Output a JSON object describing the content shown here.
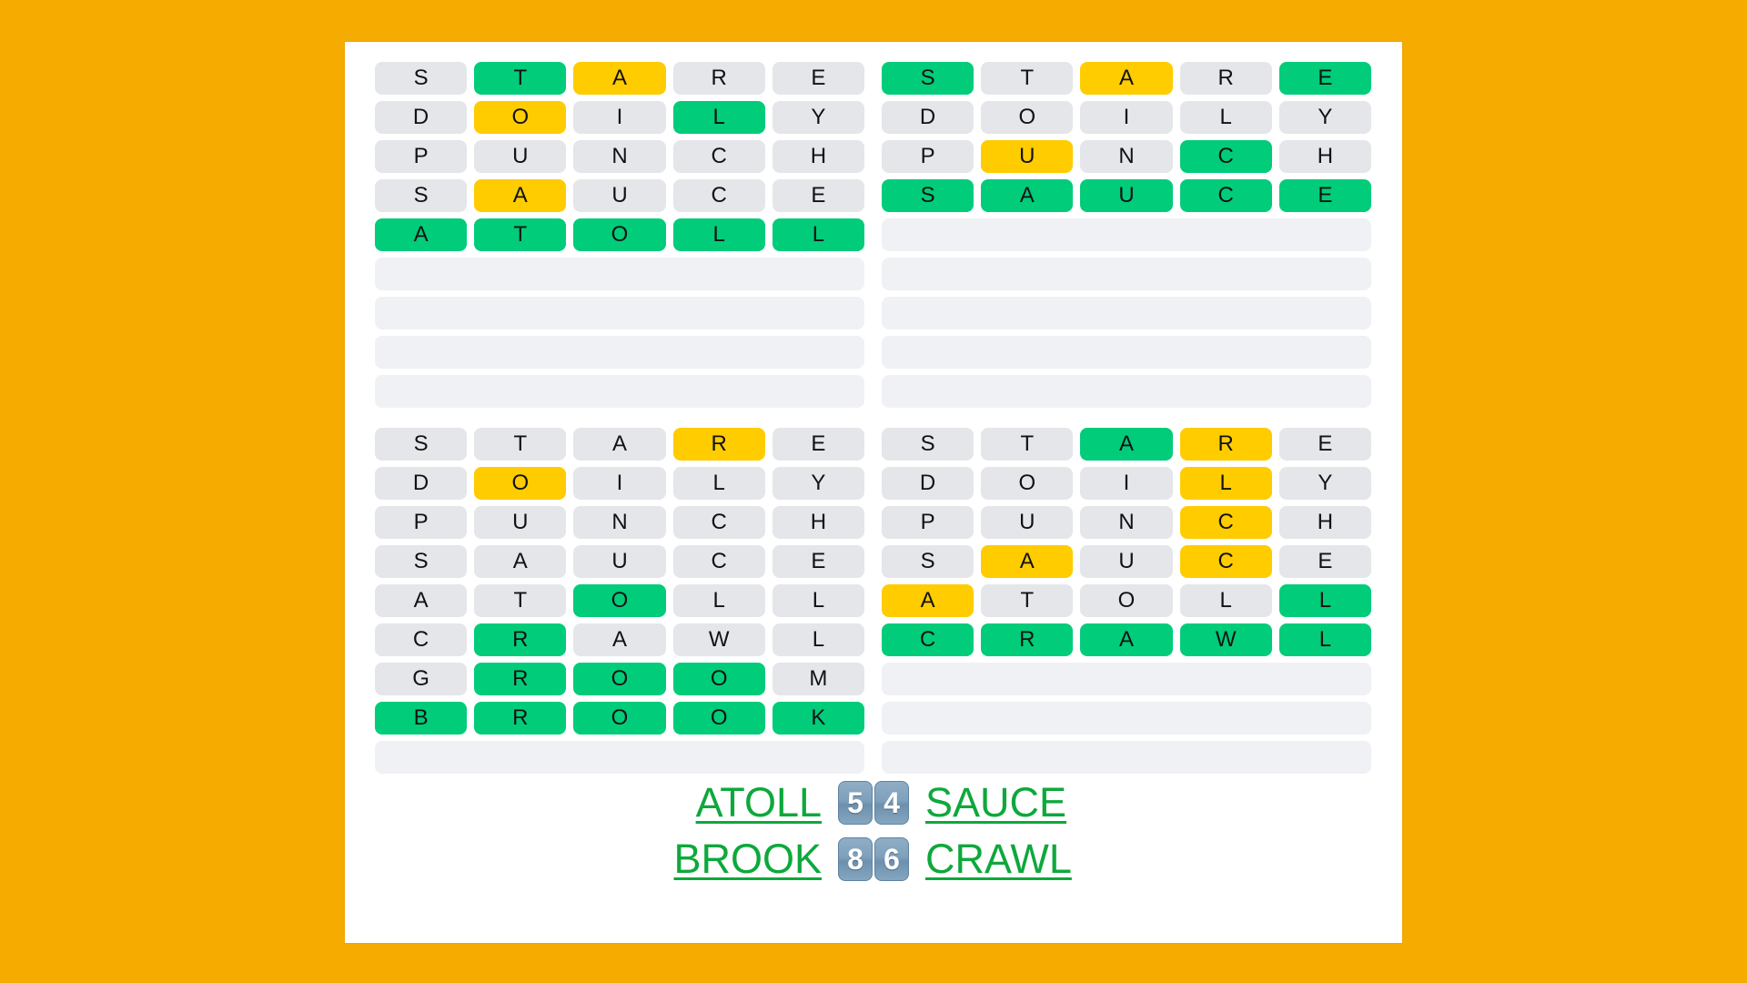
{
  "page": {
    "background_color": "#f5ab00",
    "card_color": "#ffffff"
  },
  "colors": {
    "correct": "#00cc7a",
    "present": "#ffcc00",
    "absent": "#e4e6ea",
    "empty_row": "#f0f1f4",
    "word_link": "#0ea83c",
    "number_box": "#7fa0bb"
  },
  "boards": [
    {
      "id": "board-top-left",
      "rows": [
        {
          "letters": [
            "S",
            "T",
            "A",
            "R",
            "E"
          ],
          "states": [
            "absent",
            "correct",
            "present",
            "absent",
            "absent"
          ]
        },
        {
          "letters": [
            "D",
            "O",
            "I",
            "L",
            "Y"
          ],
          "states": [
            "absent",
            "present",
            "absent",
            "correct",
            "absent"
          ]
        },
        {
          "letters": [
            "P",
            "U",
            "N",
            "C",
            "H"
          ],
          "states": [
            "absent",
            "absent",
            "absent",
            "absent",
            "absent"
          ]
        },
        {
          "letters": [
            "S",
            "A",
            "U",
            "C",
            "E"
          ],
          "states": [
            "absent",
            "present",
            "absent",
            "absent",
            "absent"
          ]
        },
        {
          "letters": [
            "A",
            "T",
            "O",
            "L",
            "L"
          ],
          "states": [
            "correct",
            "correct",
            "correct",
            "correct",
            "correct"
          ]
        }
      ],
      "empty_rows": 4
    },
    {
      "id": "board-top-right",
      "rows": [
        {
          "letters": [
            "S",
            "T",
            "A",
            "R",
            "E"
          ],
          "states": [
            "correct",
            "absent",
            "present",
            "absent",
            "correct"
          ]
        },
        {
          "letters": [
            "D",
            "O",
            "I",
            "L",
            "Y"
          ],
          "states": [
            "absent",
            "absent",
            "absent",
            "absent",
            "absent"
          ]
        },
        {
          "letters": [
            "P",
            "U",
            "N",
            "C",
            "H"
          ],
          "states": [
            "absent",
            "present",
            "absent",
            "correct",
            "absent"
          ]
        },
        {
          "letters": [
            "S",
            "A",
            "U",
            "C",
            "E"
          ],
          "states": [
            "correct",
            "correct",
            "correct",
            "correct",
            "correct"
          ]
        }
      ],
      "empty_rows": 5
    },
    {
      "id": "board-bottom-left",
      "rows": [
        {
          "letters": [
            "S",
            "T",
            "A",
            "R",
            "E"
          ],
          "states": [
            "absent",
            "absent",
            "absent",
            "present",
            "absent"
          ]
        },
        {
          "letters": [
            "D",
            "O",
            "I",
            "L",
            "Y"
          ],
          "states": [
            "absent",
            "present",
            "absent",
            "absent",
            "absent"
          ]
        },
        {
          "letters": [
            "P",
            "U",
            "N",
            "C",
            "H"
          ],
          "states": [
            "absent",
            "absent",
            "absent",
            "absent",
            "absent"
          ]
        },
        {
          "letters": [
            "S",
            "A",
            "U",
            "C",
            "E"
          ],
          "states": [
            "absent",
            "absent",
            "absent",
            "absent",
            "absent"
          ]
        },
        {
          "letters": [
            "A",
            "T",
            "O",
            "L",
            "L"
          ],
          "states": [
            "absent",
            "absent",
            "correct",
            "absent",
            "absent"
          ]
        },
        {
          "letters": [
            "C",
            "R",
            "A",
            "W",
            "L"
          ],
          "states": [
            "absent",
            "correct",
            "absent",
            "absent",
            "absent"
          ]
        },
        {
          "letters": [
            "G",
            "R",
            "O",
            "O",
            "M"
          ],
          "states": [
            "absent",
            "correct",
            "correct",
            "correct",
            "absent"
          ]
        },
        {
          "letters": [
            "B",
            "R",
            "O",
            "O",
            "K"
          ],
          "states": [
            "correct",
            "correct",
            "correct",
            "correct",
            "correct"
          ]
        }
      ],
      "empty_rows": 1
    },
    {
      "id": "board-bottom-right",
      "rows": [
        {
          "letters": [
            "S",
            "T",
            "A",
            "R",
            "E"
          ],
          "states": [
            "absent",
            "absent",
            "correct",
            "present",
            "absent"
          ]
        },
        {
          "letters": [
            "D",
            "O",
            "I",
            "L",
            "Y"
          ],
          "states": [
            "absent",
            "absent",
            "absent",
            "present",
            "absent"
          ]
        },
        {
          "letters": [
            "P",
            "U",
            "N",
            "C",
            "H"
          ],
          "states": [
            "absent",
            "absent",
            "absent",
            "present",
            "absent"
          ]
        },
        {
          "letters": [
            "S",
            "A",
            "U",
            "C",
            "E"
          ],
          "states": [
            "absent",
            "present",
            "absent",
            "present",
            "absent"
          ]
        },
        {
          "letters": [
            "A",
            "T",
            "O",
            "L",
            "L"
          ],
          "states": [
            "present",
            "absent",
            "absent",
            "absent",
            "correct"
          ]
        },
        {
          "letters": [
            "C",
            "R",
            "A",
            "W",
            "L"
          ],
          "states": [
            "correct",
            "correct",
            "correct",
            "correct",
            "correct"
          ]
        }
      ],
      "empty_rows": 3
    }
  ],
  "answers": {
    "lines": [
      {
        "left_word": "ATOLL",
        "left_number": "5",
        "right_number": "4",
        "right_word": "SAUCE"
      },
      {
        "left_word": "BROOK",
        "left_number": "8",
        "right_number": "6",
        "right_word": "CRAWL"
      }
    ]
  }
}
